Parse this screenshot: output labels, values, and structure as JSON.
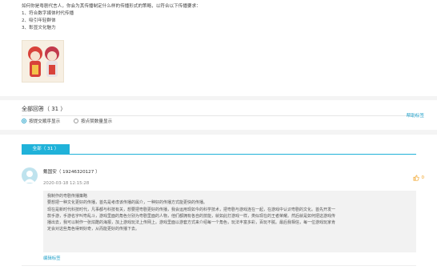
{
  "question": {
    "lines": [
      "如何你是粤剧代言人，你会为其传播制定什么样的传播形式的策略，以符合以下传播要求：",
      "1、符合数字媒体时代传播",
      "2、吸引年轻群体",
      "3、彰显文化魅力"
    ]
  },
  "answers_header": {
    "count_label": "全部回答（ 31 ）",
    "sort_time_label": "按提交顺序显示",
    "sort_votes_label": "按点赞数量显示",
    "help_link": "帮助标签"
  },
  "tabs": {
    "all_label": "全部（ 31 ）"
  },
  "answer": {
    "user": "戴国安（ 19246320127 ）",
    "time": "2020-03-18 12:15:28",
    "likes": "0",
    "lines": [
      "我制作的粤剧传播策略",
      "    要想把一种文化更好的传播，首先是考虑该传播的属介，一种好的传播方式能更快的传播。",
      "    现在是新时代科技时代，凡事都与科技有关，想要把粤剧更好的传播，我会运用现如今的科学技术，把粤剧与游戏连在一起，在游戏中认识粤剧的文化。首先开发一",
      "款手游，手游名字叫粤乱斗，游戏里面的角色分别为粤剧里面的人物，他们都拥有各自的技能，就如此打游戏一样，类似现在的王者荣耀。然后就是如何把这游戏传",
      "播出去，我可以制作一张炫酷的海报，加上游戏玩法上传网上。游戏里面以游套方式来介绍每一个角色，玩法丰富多彩，百玩不腻。最后我相信，每一位游戏玩家肯",
      "定会对这些角色得到好奇，从而能更好的传播下去。"
    ],
    "edit_label": "编辑标签"
  },
  "colors": {
    "accent": "#20b2d9",
    "like": "#f0a020"
  }
}
